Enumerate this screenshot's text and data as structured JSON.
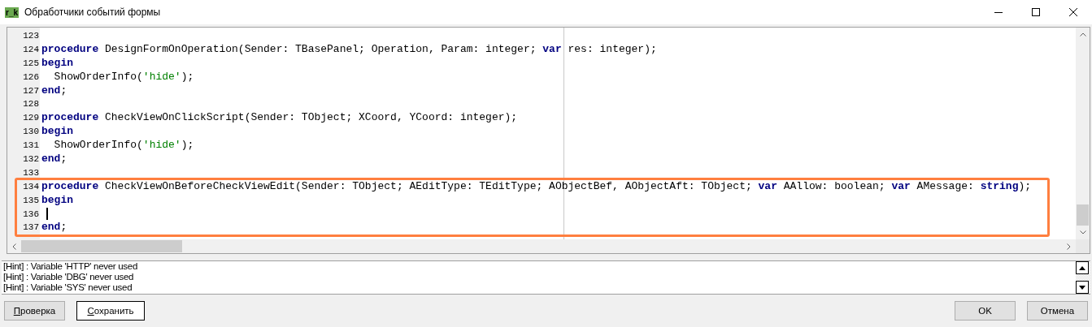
{
  "window": {
    "app_icon_text": "r_k",
    "title": "Обработчики событий формы"
  },
  "editor": {
    "lines": [
      {
        "number": "123",
        "highlighted": false,
        "cursor": false
      },
      {
        "number": "124",
        "highlighted": false,
        "cursor": false,
        "tokens": [
          {
            "kind": "keyword",
            "text": "procedure"
          },
          {
            "kind": "plain",
            "text": " DesignFormOnOperation(Sender: TBasePanel; Operation, Param: integer; "
          },
          {
            "kind": "keyword",
            "text": "var"
          },
          {
            "kind": "plain",
            "text": " res: integer);"
          }
        ]
      },
      {
        "number": "125",
        "highlighted": false,
        "cursor": false,
        "tokens": [
          {
            "kind": "keyword",
            "text": "begin"
          }
        ]
      },
      {
        "number": "126",
        "highlighted": false,
        "cursor": false,
        "tokens": [
          {
            "kind": "plain",
            "text": "  ShowOrderInfo("
          },
          {
            "kind": "string",
            "text": "'hide'"
          },
          {
            "kind": "plain",
            "text": ");"
          }
        ]
      },
      {
        "number": "127",
        "highlighted": false,
        "cursor": false,
        "tokens": [
          {
            "kind": "keyword",
            "text": "end"
          },
          {
            "kind": "plain",
            "text": ";"
          }
        ]
      },
      {
        "number": "128",
        "highlighted": false,
        "cursor": false
      },
      {
        "number": "129",
        "highlighted": false,
        "cursor": false,
        "tokens": [
          {
            "kind": "keyword",
            "text": "procedure"
          },
          {
            "kind": "plain",
            "text": " CheckViewOnClickScript(Sender: TObject; XCoord, YCoord: integer);"
          }
        ]
      },
      {
        "number": "130",
        "highlighted": false,
        "cursor": false,
        "tokens": [
          {
            "kind": "keyword",
            "text": "begin"
          }
        ]
      },
      {
        "number": "131",
        "highlighted": false,
        "cursor": false,
        "tokens": [
          {
            "kind": "plain",
            "text": "  ShowOrderInfo("
          },
          {
            "kind": "string",
            "text": "'hide'"
          },
          {
            "kind": "plain",
            "text": ");"
          }
        ]
      },
      {
        "number": "132",
        "highlighted": false,
        "cursor": false,
        "tokens": [
          {
            "kind": "keyword",
            "text": "end"
          },
          {
            "kind": "plain",
            "text": ";"
          }
        ]
      },
      {
        "number": "133",
        "highlighted": false,
        "cursor": false
      },
      {
        "number": "134",
        "highlighted": true,
        "cursor": false,
        "tokens": [
          {
            "kind": "keyword",
            "text": "procedure"
          },
          {
            "kind": "plain",
            "text": " CheckViewOnBeforeCheckViewEdit(Sender: TObject; AEditType: TEditType; AObjectBef, AObjectAft: TObject; "
          },
          {
            "kind": "keyword",
            "text": "var"
          },
          {
            "kind": "plain",
            "text": " AAllow: boolean; "
          },
          {
            "kind": "keyword",
            "text": "var"
          },
          {
            "kind": "plain",
            "text": " AMessage: "
          },
          {
            "kind": "keyword",
            "text": "string"
          },
          {
            "kind": "plain",
            "text": ");"
          }
        ]
      },
      {
        "number": "135",
        "highlighted": true,
        "cursor": false,
        "tokens": [
          {
            "kind": "keyword",
            "text": "begin"
          }
        ]
      },
      {
        "number": "136",
        "highlighted": true,
        "cursor": true
      },
      {
        "number": "137",
        "highlighted": true,
        "cursor": false,
        "tokens": [
          {
            "kind": "keyword",
            "text": "end"
          },
          {
            "kind": "plain",
            "text": ";"
          }
        ]
      }
    ]
  },
  "messages": [
    "[Hint] : Variable 'HTTP' never used",
    "[Hint] : Variable 'DBG' never used",
    "[Hint] : Variable 'SYS' never used"
  ],
  "left_buttons": [
    {
      "label": "Проверка",
      "mnemonic": true,
      "focused": false
    },
    {
      "label": "Сохранить",
      "mnemonic": true,
      "focused": true
    }
  ],
  "right_buttons": [
    {
      "label": "OK",
      "mnemonic": false,
      "focused": false
    },
    {
      "label": "Отмена",
      "mnemonic": false,
      "focused": false
    }
  ]
}
